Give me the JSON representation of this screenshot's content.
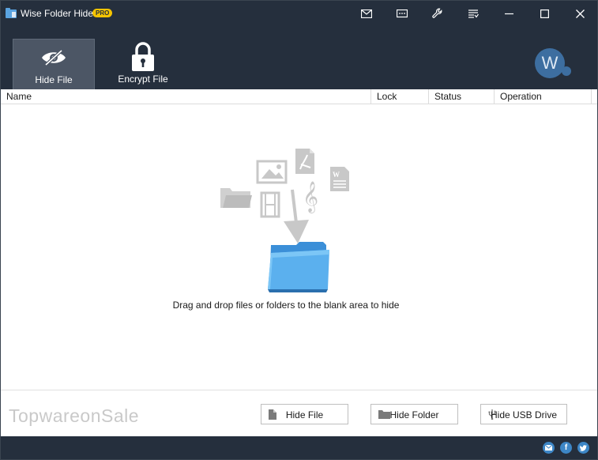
{
  "window": {
    "title": "Wise Folder Hider",
    "badge": "PRO"
  },
  "title_buttons": [
    {
      "name": "mail-icon"
    },
    {
      "name": "feedback-icon"
    },
    {
      "name": "settings-icon"
    },
    {
      "name": "menu-icon"
    },
    {
      "name": "minimize-icon"
    },
    {
      "name": "maximize-icon"
    },
    {
      "name": "close-icon"
    }
  ],
  "toolbar": {
    "hide_file": "Hide File",
    "encrypt_file": "Encrypt File",
    "avatar_letter": "W"
  },
  "table": {
    "columns": [
      "Name",
      "Lock",
      "Status",
      "Operation"
    ]
  },
  "drop_area": {
    "hint": "Drag and drop files or folders to the blank area to hide"
  },
  "bottom": {
    "watermark": "TopwareonSale",
    "hide_file_button": "Hide File",
    "hide_folder_button": "Hide Folder",
    "hide_usb_button": "Hide USB Drive"
  },
  "social": {
    "facebook": "f"
  },
  "colors": {
    "dark_bar": "#252f3d",
    "active_tab": "#4c5665",
    "accent_blue": "#3d86c6",
    "badge_yellow": "#f5c400"
  }
}
